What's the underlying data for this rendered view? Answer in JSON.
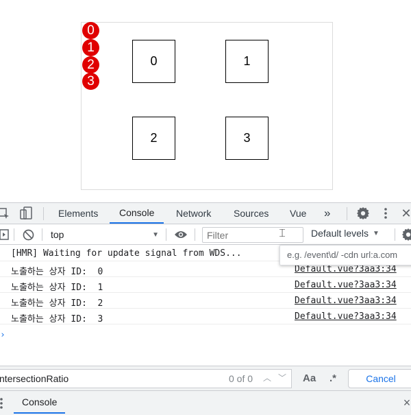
{
  "page": {
    "boxes": [
      "0",
      "1",
      "2",
      "3"
    ],
    "badges": [
      "0",
      "1",
      "2",
      "3"
    ]
  },
  "devtools": {
    "tabs": [
      "Elements",
      "Console",
      "Network",
      "Sources",
      "Vue"
    ],
    "more_tabs": "»",
    "active_tab": "Console",
    "context": "top",
    "filter_placeholder": "Filter",
    "levels": "Default levels",
    "filter_tooltip": "e.g. /event\\d/ -cdn url:a.com",
    "console": {
      "hmr_message": "[HMR] Waiting for update signal from WDS...",
      "logs": [
        {
          "message": "노출하는 상자 ID:  0",
          "source": "Default.vue?3aa3:34"
        },
        {
          "message": "노출하는 상자 ID:  1",
          "source": "Default.vue?3aa3:34"
        },
        {
          "message": "노출하는 상자 ID:  2",
          "source": "Default.vue?3aa3:34"
        },
        {
          "message": "노출하는 상자 ID:  3",
          "source": "Default.vue?3aa3:34"
        }
      ],
      "prompt": "›"
    },
    "search": {
      "value": "ntersectionRatio",
      "count": "0 of 0",
      "match_case": "Aa",
      "regex": ".*",
      "cancel": "Cancel"
    },
    "drawer": {
      "tab": "Console",
      "close": "×"
    }
  },
  "colors": {
    "badge": "#e00000",
    "accent": "#1a73e8"
  }
}
